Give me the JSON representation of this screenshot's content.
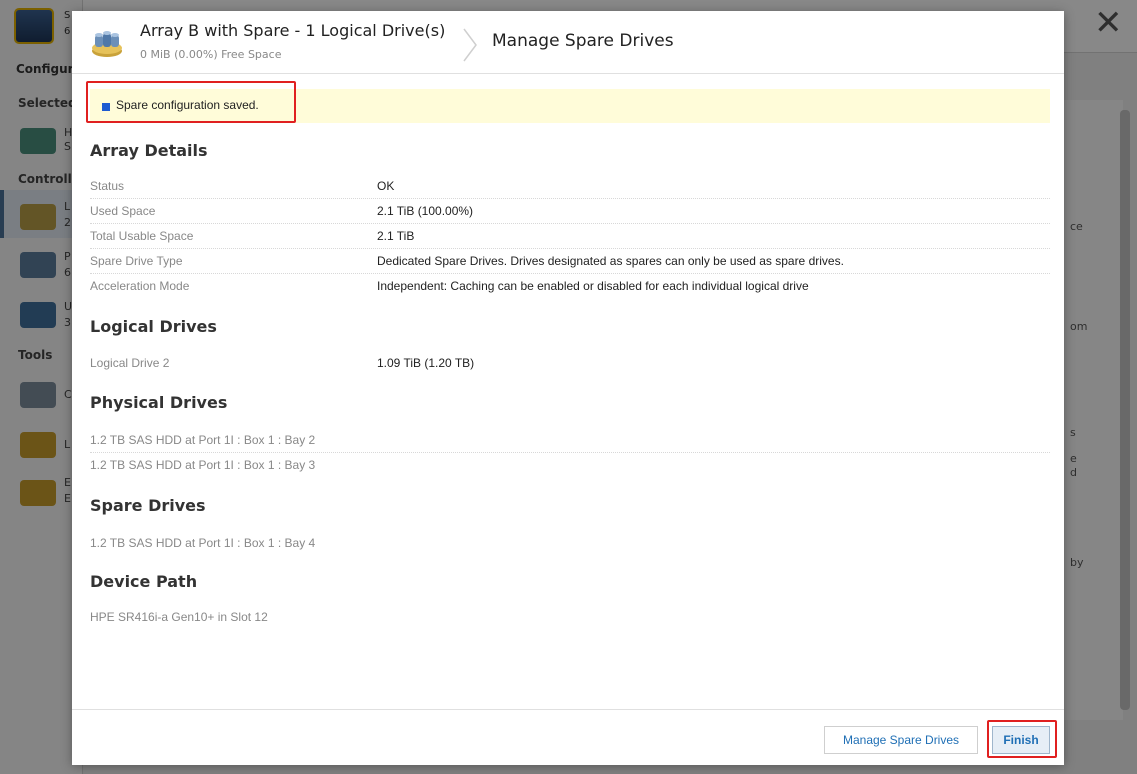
{
  "background": {
    "logo_text_top": "S",
    "logo_text_bottom": "6",
    "sidebar_sections": [
      "Configur",
      "Selected",
      "Controlle",
      "Tools"
    ],
    "sidebar_letters": [
      "H",
      "S",
      "L",
      "2",
      "P",
      "6",
      "U",
      "3",
      "C",
      "L",
      "E",
      "E"
    ],
    "main_snippets": [
      "ce",
      "om",
      "s",
      "e",
      "d",
      "by"
    ]
  },
  "modal": {
    "header": {
      "title": "Array B with Spare - 1 Logical Drive(s)",
      "subtitle": "0 MiB (0.00%) Free Space",
      "page_title": "Manage Spare Drives"
    },
    "banner": {
      "message": "Spare configuration saved."
    },
    "sections": {
      "array_details": {
        "title": "Array Details",
        "rows": [
          {
            "label": "Status",
            "value": "OK"
          },
          {
            "label": "Used Space",
            "value": "2.1 TiB (100.00%)"
          },
          {
            "label": "Total Usable Space",
            "value": "2.1 TiB"
          },
          {
            "label": "Spare Drive Type",
            "value": "Dedicated Spare Drives. Drives designated as spares can only be used as spare drives."
          },
          {
            "label": "Acceleration Mode",
            "value": "Independent: Caching can be enabled or disabled for each individual logical drive"
          }
        ]
      },
      "logical_drives": {
        "title": "Logical Drives",
        "rows": [
          {
            "label": "Logical Drive 2",
            "value": "1.09 TiB (1.20 TB)"
          }
        ]
      },
      "physical_drives": {
        "title": "Physical Drives",
        "rows": [
          {
            "label": "1.2 TB SAS HDD at Port 1I : Box 1 : Bay 2"
          },
          {
            "label": "1.2 TB SAS HDD at Port 1I : Box 1 : Bay 3"
          }
        ]
      },
      "spare_drives": {
        "title": "Spare Drives",
        "rows": [
          {
            "label": "1.2 TB SAS HDD at Port 1I : Box 1 : Bay 4"
          }
        ]
      },
      "device_path": {
        "title": "Device Path",
        "rows": [
          {
            "label": "HPE SR416i-a Gen10+ in Slot 12"
          }
        ]
      }
    },
    "footer": {
      "manage_label": "Manage Spare Drives",
      "finish_label": "Finish"
    }
  },
  "colors": {
    "accent": "#1f6fb5",
    "banner_bg": "#fffcd9",
    "highlight": "#e02020",
    "status_square": "#1e5bd1"
  }
}
